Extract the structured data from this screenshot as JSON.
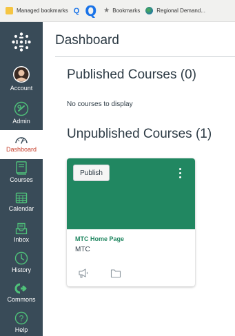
{
  "bookmarks_bar": {
    "items": [
      {
        "label": "Managed bookmarks",
        "icon": "folder-icon"
      },
      {
        "label": "Q",
        "icon": "q-small-icon"
      },
      {
        "label": "Q",
        "icon": "q-large-icon"
      },
      {
        "label": "Bookmarks",
        "icon": "star-icon"
      },
      {
        "label": "Regional Demand...",
        "icon": "globe-icon"
      }
    ]
  },
  "nav": {
    "items": [
      {
        "label": "Account",
        "icon": "avatar-icon"
      },
      {
        "label": "Admin",
        "icon": "shield-icon"
      },
      {
        "label": "Dashboard",
        "icon": "speedometer-icon",
        "active": true
      },
      {
        "label": "Courses",
        "icon": "book-icon"
      },
      {
        "label": "Calendar",
        "icon": "calendar-icon"
      },
      {
        "label": "Inbox",
        "icon": "inbox-icon"
      },
      {
        "label": "History",
        "icon": "clock-icon"
      },
      {
        "label": "Commons",
        "icon": "commons-arrow-icon"
      },
      {
        "label": "Help",
        "icon": "help-icon"
      }
    ]
  },
  "main": {
    "title": "Dashboard",
    "published": {
      "heading": "Published Courses (0)",
      "empty_message": "No courses to display"
    },
    "unpublished": {
      "heading": "Unpublished Courses (1)",
      "courses": [
        {
          "publish_label": "Publish",
          "name": "MTC Home Page",
          "code": "MTC",
          "icons": [
            "announcements-icon",
            "files-icon"
          ]
        }
      ]
    }
  },
  "colors": {
    "nav_bg": "#394b58",
    "nav_active_text": "#c63e2b",
    "accent_green": "#218761",
    "card_hero": "#218761",
    "text_dark": "#2d3b45"
  }
}
